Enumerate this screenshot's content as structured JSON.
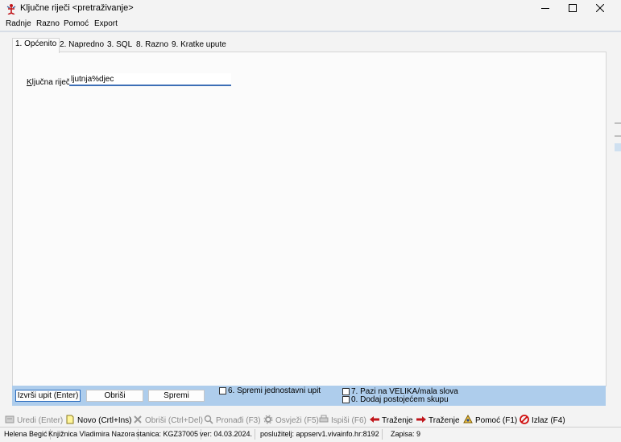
{
  "window": {
    "title": "Ključne riječi  <pretraživanje>"
  },
  "menu": [
    "Radnje",
    "Razno",
    "Pomoć",
    "Export"
  ],
  "tabs": [
    {
      "label": "1. Općenito",
      "active": true
    },
    {
      "label": "2. Napredno",
      "active": false
    },
    {
      "label": "3. SQL",
      "active": false
    },
    {
      "label": "8. Razno",
      "active": false
    },
    {
      "label": "9. Kratke upute",
      "active": false
    }
  ],
  "form": {
    "keyword_label_u": "K",
    "keyword_label_rest": "ljučna riječ",
    "keyword_value": "ljutnja%djec"
  },
  "actions": {
    "execute": "Izvrši upit (Enter)",
    "delete": "Obriši",
    "save": "Spremi",
    "cb_save_simple": "6. Spremi jednostavni upit",
    "cb_case": "7. Pazi na VELIKA/mala slova",
    "cb_add_existing": "0. Dodaj postojećem skupu"
  },
  "toolbar": {
    "edit": "Uredi (Enter)",
    "new": "Novo (Crtl+Ins)",
    "delete": "Obriši (Ctrl+Del)",
    "find": "Pronađi (F3)",
    "refresh": "Osvježi (F5)",
    "print": "Ispiši (F6)",
    "search_back": "Traženje",
    "search_forward": "Traženje",
    "help": "Pomoć (F1)",
    "exit": "Izlaz (F4)"
  },
  "status": {
    "user": "Helena Begić",
    "library": "Knjižnica Vladimira Nazora",
    "station": "stanica: KGZ37005",
    "version": "ver: 04.03.2024.",
    "server": "poslužitelj: appserv1.vivainfo.hr:8192",
    "records": "Zapisa: 9"
  },
  "colors": {
    "accent": "#3d6fb6",
    "action_bar": "#aecdec",
    "red_arrow": "#c0161b"
  }
}
